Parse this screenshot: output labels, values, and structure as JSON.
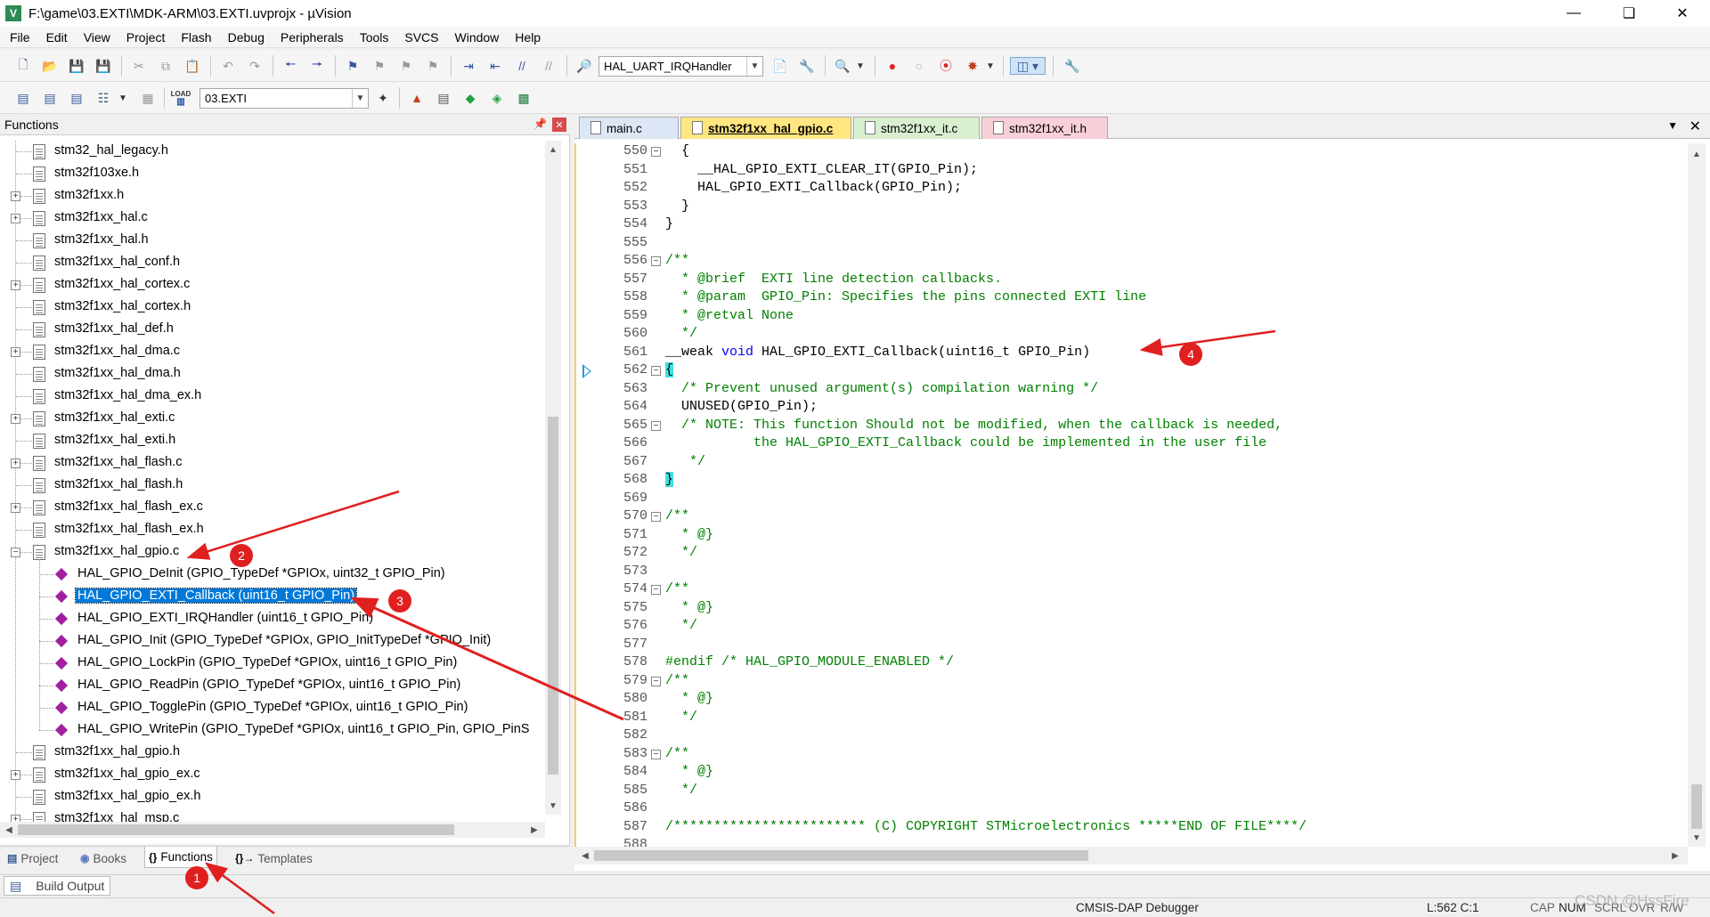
{
  "window": {
    "title": "F:\\game\\03.EXTI\\MDK-ARM\\03.EXTI.uvprojx - µVision",
    "app_icon_glyph": "V"
  },
  "menu": [
    "File",
    "Edit",
    "View",
    "Project",
    "Flash",
    "Debug",
    "Peripherals",
    "Tools",
    "SVCS",
    "Window",
    "Help"
  ],
  "toolbar": {
    "function_combo": "HAL_UART_IRQHandler",
    "target_combo": "03.EXTI",
    "load_label": "LOAD"
  },
  "functions_panel": {
    "title": "Functions",
    "items": [
      {
        "type": "file",
        "label": "stm32_hal_legacy.h",
        "expander": ""
      },
      {
        "type": "file",
        "label": "stm32f103xe.h",
        "expander": ""
      },
      {
        "type": "file",
        "label": "stm32f1xx.h",
        "expander": "+"
      },
      {
        "type": "file",
        "label": "stm32f1xx_hal.c",
        "expander": "+"
      },
      {
        "type": "file",
        "label": "stm32f1xx_hal.h",
        "expander": ""
      },
      {
        "type": "file",
        "label": "stm32f1xx_hal_conf.h",
        "expander": ""
      },
      {
        "type": "file",
        "label": "stm32f1xx_hal_cortex.c",
        "expander": "+"
      },
      {
        "type": "file",
        "label": "stm32f1xx_hal_cortex.h",
        "expander": ""
      },
      {
        "type": "file",
        "label": "stm32f1xx_hal_def.h",
        "expander": ""
      },
      {
        "type": "file",
        "label": "stm32f1xx_hal_dma.c",
        "expander": "+"
      },
      {
        "type": "file",
        "label": "stm32f1xx_hal_dma.h",
        "expander": ""
      },
      {
        "type": "file",
        "label": "stm32f1xx_hal_dma_ex.h",
        "expander": ""
      },
      {
        "type": "file",
        "label": "stm32f1xx_hal_exti.c",
        "expander": "+"
      },
      {
        "type": "file",
        "label": "stm32f1xx_hal_exti.h",
        "expander": ""
      },
      {
        "type": "file",
        "label": "stm32f1xx_hal_flash.c",
        "expander": "+"
      },
      {
        "type": "file",
        "label": "stm32f1xx_hal_flash.h",
        "expander": ""
      },
      {
        "type": "file",
        "label": "stm32f1xx_hal_flash_ex.c",
        "expander": "+"
      },
      {
        "type": "file",
        "label": "stm32f1xx_hal_flash_ex.h",
        "expander": ""
      },
      {
        "type": "file",
        "label": "stm32f1xx_hal_gpio.c",
        "expander": "-"
      },
      {
        "type": "func",
        "label": "HAL_GPIO_DeInit (GPIO_TypeDef *GPIOx, uint32_t GPIO_Pin)"
      },
      {
        "type": "func",
        "label": "HAL_GPIO_EXTI_Callback (uint16_t GPIO_Pin)",
        "selected": true
      },
      {
        "type": "func",
        "label": "HAL_GPIO_EXTI_IRQHandler (uint16_t GPIO_Pin)"
      },
      {
        "type": "func",
        "label": "HAL_GPIO_Init (GPIO_TypeDef *GPIOx, GPIO_InitTypeDef *GPIO_Init)"
      },
      {
        "type": "func",
        "label": "HAL_GPIO_LockPin (GPIO_TypeDef *GPIOx, uint16_t GPIO_Pin)"
      },
      {
        "type": "func",
        "label": "HAL_GPIO_ReadPin (GPIO_TypeDef *GPIOx, uint16_t GPIO_Pin)"
      },
      {
        "type": "func",
        "label": "HAL_GPIO_TogglePin (GPIO_TypeDef *GPIOx, uint16_t GPIO_Pin)"
      },
      {
        "type": "func",
        "label": "HAL_GPIO_WritePin (GPIO_TypeDef *GPIOx, uint16_t GPIO_Pin, GPIO_PinS"
      },
      {
        "type": "file",
        "label": "stm32f1xx_hal_gpio.h",
        "expander": ""
      },
      {
        "type": "file",
        "label": "stm32f1xx_hal_gpio_ex.c",
        "expander": "+"
      },
      {
        "type": "file",
        "label": "stm32f1xx_hal_gpio_ex.h",
        "expander": ""
      },
      {
        "type": "file",
        "label": "stm32f1xx_hal_msp.c",
        "expander": "+"
      }
    ],
    "tabs": [
      {
        "label": "Project",
        "icon": "project-icon"
      },
      {
        "label": "Books",
        "icon": "books-icon"
      },
      {
        "label": "Functions",
        "icon": "braces-icon",
        "active": true
      },
      {
        "label": "Templates",
        "icon": "templates-icon"
      }
    ]
  },
  "editor": {
    "tabs": [
      {
        "label": "main.c",
        "active": false,
        "color": "#dde6f5"
      },
      {
        "label": "stm32f1xx_hal_gpio.c",
        "active": true,
        "color": "#ffe680"
      },
      {
        "label": "stm32f1xx_it.c",
        "active": false,
        "color": "#d8f0d0"
      },
      {
        "label": "stm32f1xx_it.h",
        "active": false,
        "color": "#f8d0d8"
      }
    ],
    "lines": [
      {
        "n": "550",
        "fold": "-",
        "segs": [
          {
            "t": "  {"
          }
        ]
      },
      {
        "n": "551",
        "segs": [
          {
            "t": "    __HAL_GPIO_EXTI_CLEAR_IT(GPIO_Pin);"
          }
        ]
      },
      {
        "n": "552",
        "segs": [
          {
            "t": "    HAL_GPIO_EXTI_Callback(GPIO_Pin);"
          }
        ]
      },
      {
        "n": "553",
        "segs": [
          {
            "t": "  }"
          }
        ]
      },
      {
        "n": "554",
        "segs": [
          {
            "t": "}"
          }
        ]
      },
      {
        "n": "555",
        "segs": [
          {
            "t": ""
          }
        ]
      },
      {
        "n": "556",
        "fold": "-",
        "segs": [
          {
            "t": "/**",
            "c": "c-comment"
          }
        ]
      },
      {
        "n": "557",
        "segs": [
          {
            "t": "  * @brief  EXTI line detection callbacks.",
            "c": "c-comment"
          }
        ]
      },
      {
        "n": "558",
        "segs": [
          {
            "t": "  * @param  GPIO_Pin: Specifies the pins connected EXTI line",
            "c": "c-comment"
          }
        ]
      },
      {
        "n": "559",
        "segs": [
          {
            "t": "  * @retval None",
            "c": "c-comment"
          }
        ]
      },
      {
        "n": "560",
        "segs": [
          {
            "t": "  */",
            "c": "c-comment"
          }
        ]
      },
      {
        "n": "561",
        "segs": [
          {
            "t": "__weak "
          },
          {
            "t": "void",
            "c": "c-kw"
          },
          {
            "t": " HAL_GPIO_EXTI_Callback(uint16_t GPIO_Pin)"
          }
        ]
      },
      {
        "n": "562",
        "fold": "-",
        "segs": [
          {
            "t": "{",
            "c": "brace-hl"
          }
        ],
        "marker": true
      },
      {
        "n": "563",
        "segs": [
          {
            "t": "  /* Prevent unused argument(s) compilation warning */",
            "c": "c-comment"
          }
        ]
      },
      {
        "n": "564",
        "segs": [
          {
            "t": "  UNUSED(GPIO_Pin);"
          }
        ]
      },
      {
        "n": "565",
        "fold": "-",
        "segs": [
          {
            "t": "  /* NOTE: This function Should not be modified, when the callback is needed,",
            "c": "c-comment"
          }
        ]
      },
      {
        "n": "566",
        "segs": [
          {
            "t": "           the HAL_GPIO_EXTI_Callback could be implemented in the user file",
            "c": "c-comment"
          }
        ]
      },
      {
        "n": "567",
        "segs": [
          {
            "t": "   */",
            "c": "c-comment"
          }
        ]
      },
      {
        "n": "568",
        "segs": [
          {
            "t": "}",
            "c": "brace-hl"
          }
        ]
      },
      {
        "n": "569",
        "segs": [
          {
            "t": ""
          }
        ]
      },
      {
        "n": "570",
        "fold": "-",
        "segs": [
          {
            "t": "/**",
            "c": "c-comment"
          }
        ]
      },
      {
        "n": "571",
        "segs": [
          {
            "t": "  * @}",
            "c": "c-comment"
          }
        ]
      },
      {
        "n": "572",
        "segs": [
          {
            "t": "  */",
            "c": "c-comment"
          }
        ]
      },
      {
        "n": "573",
        "segs": [
          {
            "t": ""
          }
        ]
      },
      {
        "n": "574",
        "fold": "-",
        "segs": [
          {
            "t": "/**",
            "c": "c-comment"
          }
        ]
      },
      {
        "n": "575",
        "segs": [
          {
            "t": "  * @}",
            "c": "c-comment"
          }
        ]
      },
      {
        "n": "576",
        "segs": [
          {
            "t": "  */",
            "c": "c-comment"
          }
        ]
      },
      {
        "n": "577",
        "segs": [
          {
            "t": ""
          }
        ]
      },
      {
        "n": "578",
        "segs": [
          {
            "t": "#endif /* HAL_GPIO_MODULE_ENABLED */",
            "c": "c-pre"
          }
        ]
      },
      {
        "n": "579",
        "fold": "-",
        "segs": [
          {
            "t": "/**",
            "c": "c-comment"
          }
        ]
      },
      {
        "n": "580",
        "segs": [
          {
            "t": "  * @}",
            "c": "c-comment"
          }
        ]
      },
      {
        "n": "581",
        "segs": [
          {
            "t": "  */",
            "c": "c-comment"
          }
        ]
      },
      {
        "n": "582",
        "segs": [
          {
            "t": ""
          }
        ]
      },
      {
        "n": "583",
        "fold": "-",
        "segs": [
          {
            "t": "/**",
            "c": "c-comment"
          }
        ]
      },
      {
        "n": "584",
        "segs": [
          {
            "t": "  * @}",
            "c": "c-comment"
          }
        ]
      },
      {
        "n": "585",
        "segs": [
          {
            "t": "  */",
            "c": "c-comment"
          }
        ]
      },
      {
        "n": "586",
        "segs": [
          {
            "t": ""
          }
        ]
      },
      {
        "n": "587",
        "segs": [
          {
            "t": "/************************ (C) COPYRIGHT STMicroelectronics *****END OF FILE****/",
            "c": "c-comment"
          }
        ]
      },
      {
        "n": "588",
        "segs": [
          {
            "t": ""
          }
        ]
      }
    ]
  },
  "build_output": {
    "label": "Build Output"
  },
  "status": {
    "debugger": "CMSIS-DAP Debugger",
    "position": "L:562 C:1",
    "cap": "CAP",
    "num": "NUM",
    "scrl": "SCRL",
    "ovr": "OVR",
    "rw": "R/W"
  },
  "annotations": [
    "1",
    "2",
    "3",
    "4"
  ],
  "watermark": "CSDN @HssFire",
  "colors": {
    "selection": "#0078d7",
    "annotation": "#e02020",
    "keyword": "#0000ff",
    "comment": "#008000",
    "brace_highlight": "#40e0e0"
  }
}
